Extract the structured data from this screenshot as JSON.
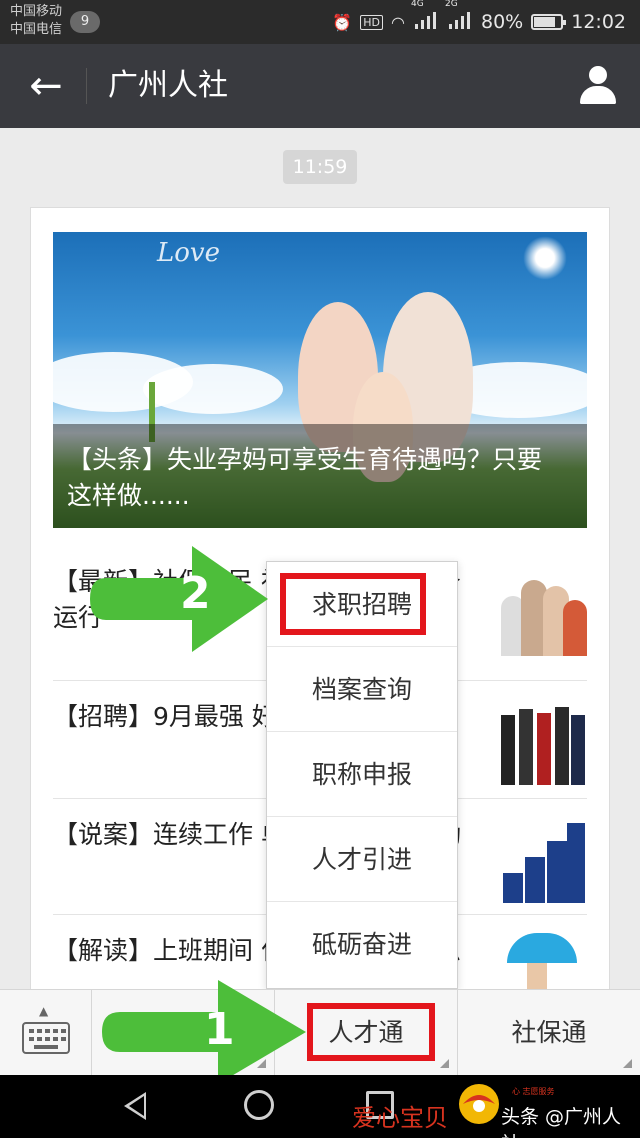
{
  "status_bar": {
    "carrier1": "中国移动",
    "carrier2": "中国电信",
    "notification_count": "9",
    "hd_label": "HD",
    "net1": "4G",
    "net2": "2G",
    "battery": "80%",
    "battery_level": 0.8,
    "time": "12:02"
  },
  "header": {
    "title": "广州人社"
  },
  "chat": {
    "timestamp": "11:59",
    "headline": "【头条】失业孕妈可享受生育待遇吗？只要这样做......",
    "banner_script": "Love",
    "articles": [
      {
        "text": "【最新】社保便民 社会保险业务服务 运行"
      },
      {
        "text": "【招聘】9月最强 好职位又呼唤你啦"
      },
      {
        "text": "【说案】连续工作 单位可以终止劳动"
      },
      {
        "text": "【解读】上班期间 作吗？原来是这么"
      }
    ]
  },
  "dropdown": {
    "items": [
      "求职招聘",
      "档案查询",
      "职称申报",
      "人才引进",
      "砥砺奋进"
    ],
    "highlighted_index": 0
  },
  "annotations": {
    "step1": "1",
    "step2": "2",
    "highlight_color": "#e3161c",
    "arrow_color": "#4dbe3a"
  },
  "bottom_menu": {
    "keyboard_icon": "keyboard-icon",
    "tabs": [
      {
        "label": ""
      },
      {
        "label": "人才通"
      },
      {
        "label": "社保通"
      }
    ]
  },
  "watermark": {
    "left": "爱心宝贝",
    "right": "头条 @广州人社",
    "small": "心 志愿服务"
  },
  "colors": {
    "header_bg": "#393a3f",
    "status_bg": "#2b2b2b",
    "page_bg": "#ebebeb"
  }
}
